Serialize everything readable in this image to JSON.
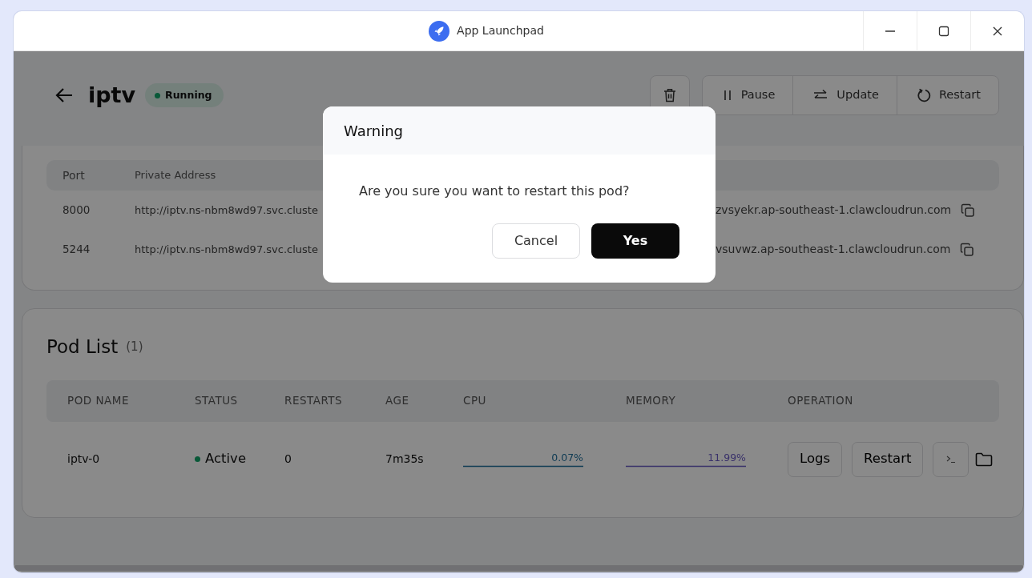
{
  "window": {
    "title": "App Launchpad"
  },
  "app": {
    "name": "iptv",
    "status": "Running"
  },
  "actions": [
    {
      "label": "Pause",
      "kind": "pause"
    },
    {
      "label": "Update",
      "kind": "update"
    },
    {
      "label": "Restart",
      "kind": "restart"
    }
  ],
  "ports": {
    "columns": [
      "Port",
      "Private Address"
    ],
    "rows": [
      {
        "port": "8000",
        "private_address": "http://iptv.ns-nbm8wd97.svc.cluste",
        "public_address": "zvsyekr.ap-southeast-1.clawcloudrun.com"
      },
      {
        "port": "5244",
        "private_address": "http://iptv.ns-nbm8wd97.svc.cluste",
        "public_address": "vsuvwz.ap-southeast-1.clawcloudrun.com"
      }
    ]
  },
  "pod_list": {
    "title": "Pod List",
    "count": "(1)",
    "columns": [
      "POD NAME",
      "STATUS",
      "RESTARTS",
      "AGE",
      "CPU",
      "MEMORY",
      "OPERATION"
    ],
    "rows": [
      {
        "pod_name": "iptv-0",
        "status": "Active",
        "restarts": "0",
        "age": "7m35s",
        "cpu": "0.07%",
        "memory": "11.99%",
        "operations": [
          "Logs",
          "Restart"
        ]
      }
    ]
  },
  "dialog": {
    "title": "Warning",
    "message": "Are you sure you want to restart this pod?",
    "buttons": [
      {
        "label": "Cancel",
        "kind": "secondary"
      },
      {
        "label": "Yes",
        "kind": "primary"
      }
    ]
  }
}
